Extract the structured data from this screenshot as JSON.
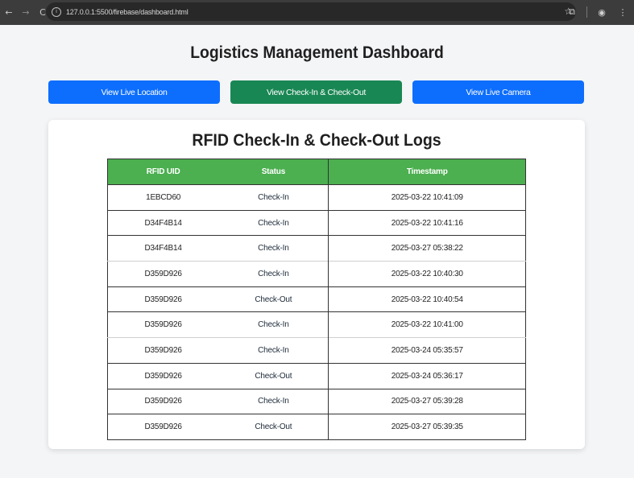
{
  "browser": {
    "url": "127.0.0.1:5500/firebase/dashboard.html"
  },
  "page": {
    "title": "Logistics Management Dashboard"
  },
  "nav_buttons": [
    {
      "label": "View Live Location",
      "color": "#0d6efd"
    },
    {
      "label": "View Check-In & Check-Out",
      "color": "#198754"
    },
    {
      "label": "View Live Camera",
      "color": "#0d6efd"
    }
  ],
  "logs": {
    "title": "RFID Check-In & Check-Out Logs",
    "header_color": "#4caf50",
    "columns": [
      "RFID UID",
      "Status",
      "Timestamp"
    ],
    "rows": [
      {
        "uid": "1EBCD60",
        "status": "Check-In",
        "timestamp": "2025-03-22 10:41:09"
      },
      {
        "uid": "D34F4B14",
        "status": "Check-In",
        "timestamp": "2025-03-22 10:41:16"
      },
      {
        "uid": "D34F4B14",
        "status": "Check-In",
        "timestamp": "2025-03-27 05:38:22"
      },
      {
        "uid": "D359D926",
        "status": "Check-In",
        "timestamp": "2025-03-22 10:40:30"
      },
      {
        "uid": "D359D926",
        "status": "Check-Out",
        "timestamp": "2025-03-22 10:40:54"
      },
      {
        "uid": "D359D926",
        "status": "Check-In",
        "timestamp": "2025-03-22 10:41:00"
      },
      {
        "uid": "D359D926",
        "status": "Check-In",
        "timestamp": "2025-03-24 05:35:57"
      },
      {
        "uid": "D359D926",
        "status": "Check-Out",
        "timestamp": "2025-03-24 05:36:17"
      },
      {
        "uid": "D359D926",
        "status": "Check-In",
        "timestamp": "2025-03-27 05:39:28"
      },
      {
        "uid": "D359D926",
        "status": "Check-Out",
        "timestamp": "2025-03-27 05:39:35"
      }
    ]
  }
}
